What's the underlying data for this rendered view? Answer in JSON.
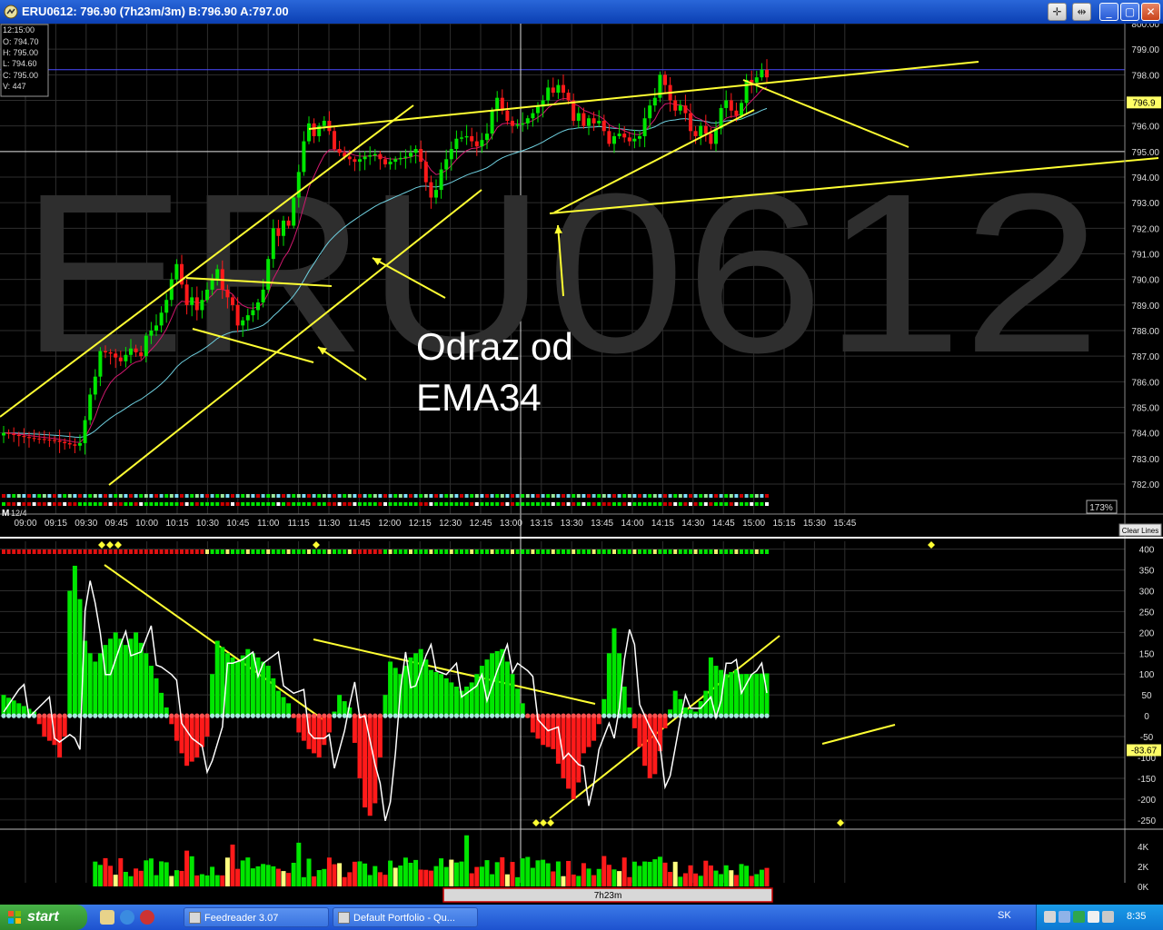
{
  "window": {
    "title": "ERU0612:  796.90  (7h23m/3m)  B:796.90  A:797.00",
    "controls": [
      "✛",
      "⇹",
      "_",
      "▢",
      "✕"
    ]
  },
  "watermark": "ERU0612",
  "ohlc_box": [
    "12:15:00",
    "O: 794.70",
    "H: 795.00",
    "L: 794.60",
    "C: 795.00",
    "V: 447"
  ],
  "annotation": {
    "line1": "Odraz od",
    "line2": "EMA34"
  },
  "chart_data": [
    {
      "type": "candlestick",
      "title": "ERU0612",
      "price_ticks": [
        "800.00",
        "799.00",
        "798.00",
        "797.00",
        "796.00",
        "795.00",
        "794.00",
        "793.00",
        "792.00",
        "791.00",
        "790.00",
        "789.00",
        "788.00",
        "787.00",
        "786.00",
        "785.00",
        "784.00",
        "783.00",
        "782.00"
      ],
      "ylim": [
        782,
        800
      ],
      "time_ticks": [
        "09:00",
        "09:15",
        "09:30",
        "09:45",
        "10:00",
        "10:15",
        "10:30",
        "10:45",
        "11:00",
        "11:15",
        "11:30",
        "11:45",
        "12:00",
        "12:15",
        "12:30",
        "12:45",
        "13:00",
        "13:15",
        "13:30",
        "13:45",
        "14:00",
        "14:15",
        "14:30",
        "14:45",
        "15:00",
        "15:15",
        "15:30",
        "15:45"
      ],
      "date_label": "12/4",
      "period_label": "M",
      "bar_interval": "3m",
      "current_price": "796.9",
      "close_anchors": [
        [
          0,
          784.0
        ],
        [
          5,
          783.8
        ],
        [
          10,
          783.7
        ],
        [
          14,
          783.5
        ],
        [
          15,
          783.6
        ],
        [
          16,
          784.5
        ],
        [
          17,
          785.5
        ],
        [
          18,
          786.2
        ],
        [
          19,
          787.2
        ],
        [
          21,
          787.1
        ],
        [
          23,
          786.8
        ],
        [
          25,
          787.3
        ],
        [
          27,
          787.0
        ],
        [
          28,
          787.8
        ],
        [
          30,
          788.2
        ],
        [
          32,
          789.2
        ],
        [
          33,
          790.0
        ],
        [
          34,
          790.6
        ],
        [
          35,
          789.8
        ],
        [
          36,
          789.0
        ],
        [
          37,
          789.3
        ],
        [
          38,
          788.8
        ],
        [
          40,
          789.6
        ],
        [
          42,
          790.4
        ],
        [
          43,
          789.6
        ],
        [
          45,
          789.0
        ],
        [
          46,
          788.2
        ],
        [
          47,
          788.4
        ],
        [
          49,
          788.8
        ],
        [
          50,
          789.1
        ],
        [
          51,
          789.6
        ],
        [
          52,
          790.8
        ],
        [
          53,
          792.0
        ],
        [
          54,
          791.7
        ],
        [
          55,
          792.3
        ],
        [
          56,
          792.1
        ],
        [
          57,
          793.2
        ],
        [
          58,
          794.2
        ],
        [
          59,
          795.4
        ],
        [
          60,
          796.1
        ],
        [
          61,
          795.6
        ],
        [
          62,
          796.0
        ],
        [
          63,
          796.2
        ],
        [
          64,
          795.8
        ],
        [
          65,
          795.1
        ],
        [
          67,
          794.8
        ],
        [
          69,
          794.6
        ],
        [
          71,
          794.8
        ],
        [
          73,
          794.9
        ],
        [
          75,
          794.5
        ],
        [
          77,
          794.7
        ],
        [
          79,
          794.8
        ],
        [
          81,
          795.1
        ],
        [
          82,
          794.6
        ],
        [
          83,
          793.8
        ],
        [
          84,
          793.2
        ],
        [
          85,
          793.5
        ],
        [
          86,
          794.3
        ],
        [
          87,
          794.7
        ],
        [
          89,
          795.5
        ],
        [
          91,
          795.6
        ],
        [
          93,
          795.2
        ],
        [
          95,
          795.7
        ],
        [
          96,
          796.6
        ],
        [
          97,
          797.1
        ],
        [
          98,
          796.6
        ],
        [
          99,
          796.2
        ],
        [
          100,
          796.0
        ],
        [
          102,
          796.1
        ],
        [
          104,
          796.5
        ],
        [
          106,
          797.0
        ],
        [
          107,
          797.5
        ],
        [
          108,
          797.3
        ],
        [
          109,
          797.6
        ],
        [
          110,
          797.3
        ],
        [
          111,
          797.0
        ],
        [
          112,
          796.2
        ],
        [
          113,
          796.5
        ],
        [
          114,
          796.0
        ],
        [
          115,
          796.3
        ],
        [
          116,
          796.1
        ],
        [
          117,
          796.2
        ],
        [
          118,
          795.8
        ],
        [
          119,
          795.3
        ],
        [
          120,
          795.6
        ],
        [
          121,
          795.7
        ],
        [
          123,
          795.4
        ],
        [
          125,
          795.6
        ],
        [
          126,
          796.3
        ],
        [
          127,
          796.8
        ],
        [
          128,
          797.1
        ],
        [
          129,
          798.0
        ],
        [
          130,
          797.6
        ],
        [
          131,
          797.0
        ],
        [
          132,
          796.6
        ],
        [
          133,
          796.8
        ],
        [
          134,
          796.5
        ],
        [
          135,
          795.8
        ],
        [
          136,
          795.6
        ],
        [
          137,
          796.0
        ],
        [
          138,
          795.7
        ],
        [
          139,
          795.3
        ],
        [
          140,
          795.9
        ],
        [
          141,
          796.7
        ],
        [
          142,
          797.0
        ],
        [
          143,
          796.6
        ],
        [
          144,
          796.4
        ],
        [
          145,
          796.9
        ],
        [
          146,
          797.8
        ],
        [
          147,
          797.7
        ],
        [
          148,
          797.9
        ],
        [
          149,
          798.2
        ],
        [
          150,
          797.9
        ]
      ],
      "ema_fast": "EMA (magenta)",
      "ema_slow": "EMA34 (light blue)"
    },
    {
      "type": "histogram",
      "oscillator_ticks": [
        "400",
        "350",
        "300",
        "250",
        "200",
        "150",
        "100",
        "50",
        "0",
        "-50",
        "-100",
        "-150",
        "-200",
        "-250"
      ],
      "ylim": [
        -270,
        410
      ],
      "current_value": "-83.67",
      "anchors": [
        [
          0,
          50
        ],
        [
          3,
          30
        ],
        [
          6,
          10
        ],
        [
          8,
          -50
        ],
        [
          10,
          -70
        ],
        [
          11,
          -100
        ],
        [
          12,
          -50
        ],
        [
          13,
          300
        ],
        [
          14,
          360
        ],
        [
          15,
          280
        ],
        [
          16,
          180
        ],
        [
          17,
          150
        ],
        [
          18,
          130
        ],
        [
          20,
          170
        ],
        [
          22,
          200
        ],
        [
          24,
          170
        ],
        [
          26,
          200
        ],
        [
          28,
          150
        ],
        [
          30,
          90
        ],
        [
          32,
          20
        ],
        [
          34,
          -60
        ],
        [
          36,
          -120
        ],
        [
          38,
          -100
        ],
        [
          40,
          -50
        ],
        [
          41,
          100
        ],
        [
          42,
          180
        ],
        [
          44,
          150
        ],
        [
          46,
          130
        ],
        [
          48,
          160
        ],
        [
          50,
          140
        ],
        [
          52,
          120
        ],
        [
          54,
          60
        ],
        [
          56,
          30
        ],
        [
          58,
          -40
        ],
        [
          60,
          -80
        ],
        [
          62,
          -100
        ],
        [
          64,
          -40
        ],
        [
          65,
          10
        ],
        [
          66,
          50
        ],
        [
          68,
          20
        ],
        [
          70,
          -150
        ],
        [
          71,
          -220
        ],
        [
          72,
          -240
        ],
        [
          73,
          -210
        ],
        [
          74,
          -100
        ],
        [
          75,
          50
        ],
        [
          76,
          130
        ],
        [
          78,
          100
        ],
        [
          80,
          140
        ],
        [
          82,
          160
        ],
        [
          84,
          110
        ],
        [
          86,
          100
        ],
        [
          88,
          80
        ],
        [
          90,
          60
        ],
        [
          92,
          80
        ],
        [
          94,
          120
        ],
        [
          96,
          150
        ],
        [
          98,
          160
        ],
        [
          100,
          100
        ],
        [
          102,
          30
        ],
        [
          104,
          -40
        ],
        [
          106,
          -70
        ],
        [
          108,
          -80
        ],
        [
          110,
          -150
        ],
        [
          112,
          -200
        ],
        [
          113,
          -160
        ],
        [
          114,
          -90
        ],
        [
          116,
          -60
        ],
        [
          117,
          -20
        ],
        [
          118,
          40
        ],
        [
          119,
          150
        ],
        [
          120,
          210
        ],
        [
          121,
          150
        ],
        [
          122,
          70
        ],
        [
          124,
          -30
        ],
        [
          126,
          -120
        ],
        [
          127,
          -150
        ],
        [
          128,
          -140
        ],
        [
          130,
          -30
        ],
        [
          132,
          60
        ],
        [
          134,
          20
        ],
        [
          136,
          10
        ],
        [
          138,
          60
        ],
        [
          139,
          140
        ],
        [
          140,
          120
        ],
        [
          142,
          100
        ],
        [
          144,
          110
        ],
        [
          145,
          100
        ]
      ]
    },
    {
      "type": "bar",
      "title": "Volume",
      "volume_ticks": [
        "4K",
        "2K",
        "0K"
      ],
      "ylim": [
        0,
        5000
      ]
    }
  ],
  "clear_lines": "Clear Lines",
  "zoom": "173%",
  "duration_label": "7h23m",
  "colors": {
    "up": "#00e600",
    "down": "#ff1a1a",
    "ema_fast": "#d0186e",
    "ema_slow": "#6fd0e0",
    "trend": "#ffff33",
    "grid": "#2e2e2e",
    "watermark": "#2e2e2e",
    "hline": "#4a4aff"
  },
  "taskbar": {
    "start": "start",
    "tasks": [
      "Feedreader 3.07",
      "Default Portfolio - Qu..."
    ],
    "lang": "SK",
    "clock": "8:35"
  }
}
